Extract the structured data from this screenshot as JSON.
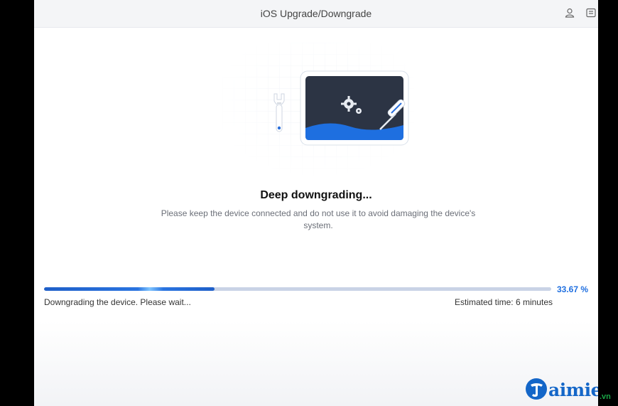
{
  "window": {
    "title": "iOS Upgrade/Downgrade"
  },
  "titlebar_icons": [
    "user-icon",
    "menu-icon"
  ],
  "main": {
    "heading": "Deep downgrading...",
    "description": "Please keep the device connected and do not use it to avoid damaging the device's system."
  },
  "progress": {
    "percent_label": "33.67 %",
    "fraction": 0.3367,
    "status_left": "Downgrading the device. Please wait...",
    "status_right": "Estimated time: 6 minutes"
  },
  "watermark": {
    "brand": "aimienphi",
    "suffix": ".vn"
  },
  "colors": {
    "accent": "#1f6fe0",
    "track": "#c9d3e6"
  }
}
